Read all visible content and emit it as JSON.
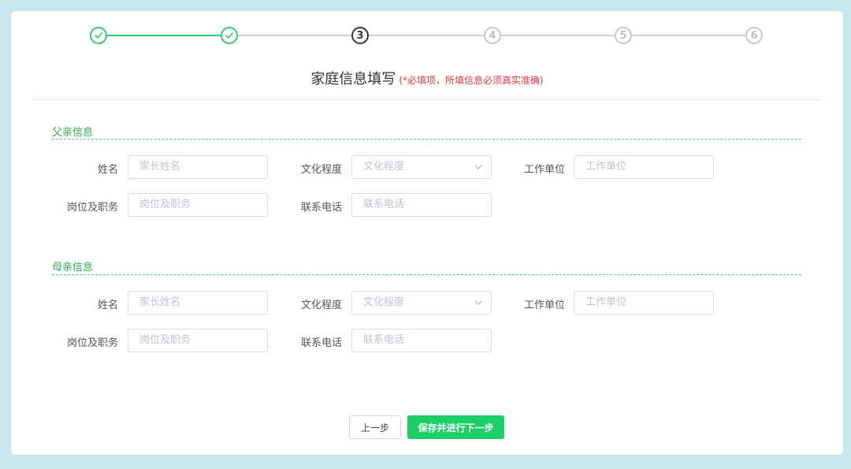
{
  "stepper": {
    "steps": [
      {
        "label": "",
        "status": "done",
        "icon": "check-icon"
      },
      {
        "label": "",
        "status": "done",
        "icon": "check-icon"
      },
      {
        "label": "3",
        "status": "current"
      },
      {
        "label": "4",
        "status": "todo"
      },
      {
        "label": "5",
        "status": "todo"
      },
      {
        "label": "6",
        "status": "todo"
      }
    ]
  },
  "header": {
    "title": "家庭信息填写",
    "note": "(*必填项，所填信息必须真实准确)"
  },
  "father": {
    "section_title": "父亲信息",
    "name_label": "姓名",
    "name_placeholder": "家长姓名",
    "education_label": "文化程度",
    "education_placeholder": "文化程度",
    "employer_label": "工作单位",
    "employer_placeholder": "工作单位",
    "position_label": "岗位及职务",
    "position_placeholder": "岗位及职务",
    "phone_label": "联系电话",
    "phone_placeholder": "联系电话"
  },
  "mother": {
    "section_title": "母亲信息",
    "name_label": "姓名",
    "name_placeholder": "家长姓名",
    "education_label": "文化程度",
    "education_placeholder": "文化程度",
    "employer_label": "工作单位",
    "employer_placeholder": "工作单位",
    "position_label": "岗位及职务",
    "position_placeholder": "岗位及职务",
    "phone_label": "联系电话",
    "phone_placeholder": "联系电话"
  },
  "actions": {
    "prev_label": "上一步",
    "next_label": "保存并进行下一步"
  },
  "colors": {
    "accent": "#2ecc71",
    "button": "#1dcf68",
    "section_title": "#2eaa4f",
    "required_note": "#e5383b"
  }
}
